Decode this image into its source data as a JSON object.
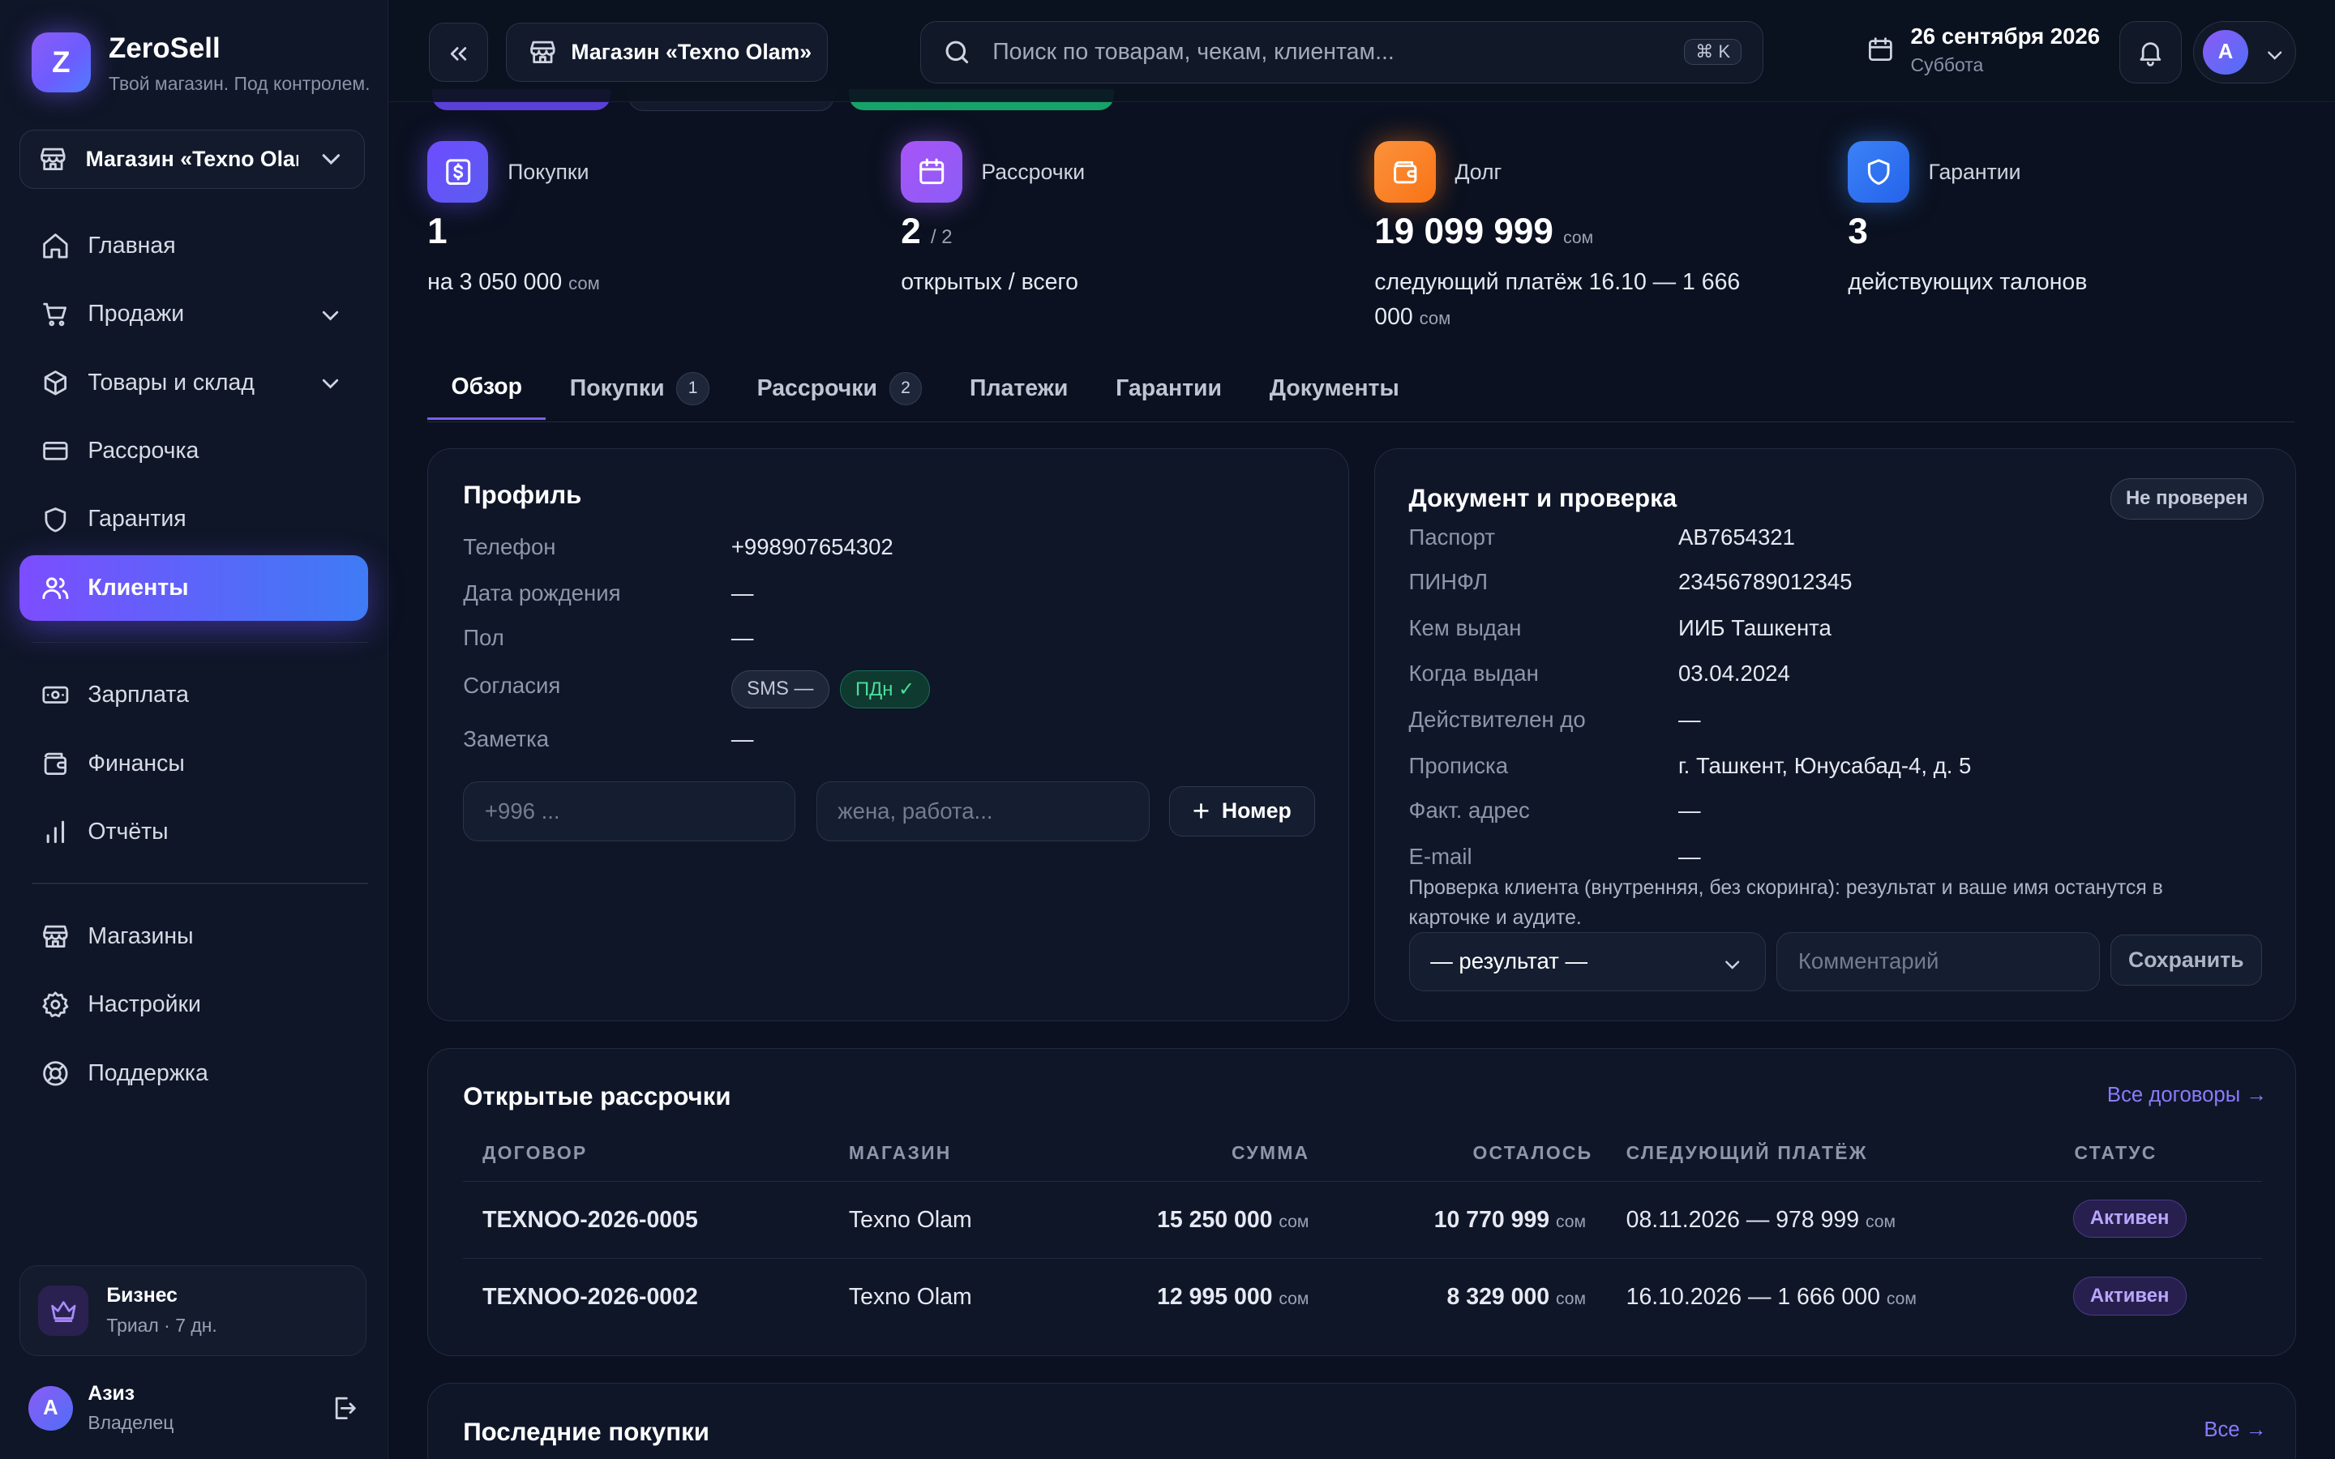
{
  "brand": {
    "name": "ZeroSell",
    "tagline": "Твой магазин. Под контролем.",
    "logo_letter": "Z"
  },
  "sidebar": {
    "store": "Магазин «Texno Olam»",
    "items": [
      {
        "label": "Главная",
        "icon": "home-icon"
      },
      {
        "label": "Продажи",
        "icon": "cart-icon",
        "expandable": true
      },
      {
        "label": "Товары и склад",
        "icon": "box-icon",
        "expandable": true
      },
      {
        "label": "Рассрочка",
        "icon": "card-icon"
      },
      {
        "label": "Гарантия",
        "icon": "shield-icon"
      },
      {
        "label": "Клиенты",
        "icon": "users-icon",
        "active": true
      },
      {
        "label": "Зарплата",
        "icon": "cash-icon"
      },
      {
        "label": "Финансы",
        "icon": "wallet-icon"
      },
      {
        "label": "Отчёты",
        "icon": "chart-icon"
      },
      {
        "label": "Магазины",
        "icon": "store-icon"
      },
      {
        "label": "Настройки",
        "icon": "gear-icon"
      },
      {
        "label": "Поддержка",
        "icon": "lifebuoy-icon"
      }
    ],
    "plan": {
      "title": "Бизнес",
      "subtitle": "Триал · 7 дн."
    },
    "user": {
      "initial": "А",
      "name": "Азиз",
      "role": "Владелец"
    }
  },
  "topbar": {
    "store": "Магазин «Texno Olam»",
    "search_placeholder": "Поиск по товарам, чекам, клиентам...",
    "shortcut": "⌘ K",
    "date": "26 сентября 2026",
    "weekday": "Суббота",
    "account_initial": "A"
  },
  "stats": [
    {
      "label": "Покупки",
      "value": "1",
      "value_suffix": "",
      "desc": "на 3 050 000",
      "desc_unit": "сом",
      "color": "#6d4dff"
    },
    {
      "label": "Рассрочки",
      "value": "2",
      "value_suffix": "/ 2",
      "desc": "открытых / всего",
      "desc_unit": "",
      "color": "#9b5cf6"
    },
    {
      "label": "Долг",
      "value": "19 099 999",
      "value_unit": "сом",
      "desc": "следующий платёж 16.10 — 1 666 000",
      "desc_unit": "сом",
      "color": "#f97316"
    },
    {
      "label": "Гарантии",
      "value": "3",
      "value_suffix": "",
      "desc": "действующих талонов",
      "desc_unit": "",
      "color": "#3b82f6"
    }
  ],
  "tabs": [
    {
      "label": "Обзор",
      "active": true
    },
    {
      "label": "Покупки",
      "count": "1"
    },
    {
      "label": "Рассрочки",
      "count": "2"
    },
    {
      "label": "Платежи"
    },
    {
      "label": "Гарантии"
    },
    {
      "label": "Документы"
    }
  ],
  "profile": {
    "title": "Профиль",
    "fields": [
      {
        "label": "Телефон",
        "value": "+998907654302"
      },
      {
        "label": "Дата рождения",
        "value": "—"
      },
      {
        "label": "Пол",
        "value": "—"
      },
      {
        "label": "Согласия",
        "value": ""
      },
      {
        "label": "Заметка",
        "value": "—"
      }
    ],
    "consents": [
      {
        "label": "SMS —"
      },
      {
        "label": "ПДн ✓"
      }
    ],
    "phone_placeholder": "+996 ...",
    "note_placeholder": "жена, работа...",
    "add_button": "Номер"
  },
  "document": {
    "title": "Документ и проверка",
    "status": "Не проверен",
    "fields": [
      {
        "label": "Паспорт",
        "value": "AB7654321"
      },
      {
        "label": "ПИНФЛ",
        "value": "23456789012345"
      },
      {
        "label": "Кем выдан",
        "value": "ИИБ Ташкента"
      },
      {
        "label": "Когда выдан",
        "value": "03.04.2024"
      },
      {
        "label": "Действителен до",
        "value": "—"
      },
      {
        "label": "Прописка",
        "value": "г. Ташкент, Юнусабад-4, д. 5"
      },
      {
        "label": "Факт. адрес",
        "value": "—"
      },
      {
        "label": "E-mail",
        "value": "—"
      }
    ],
    "note": "Проверка клиента (внутренняя, без скоринга): результат и ваше имя останутся в карточке и аудите.",
    "result_select": "— результат —",
    "comment_placeholder": "Комментарий",
    "save_button": "Сохранить"
  },
  "installments": {
    "title": "Открытые рассрочки",
    "all_link": "Все договоры →",
    "columns": [
      "ДОГОВОР",
      "МАГАЗИН",
      "СУММА",
      "ОСТАЛОСЬ",
      "СЛЕДУЮЩИЙ ПЛАТЁЖ",
      "СТАТУС"
    ],
    "rows": [
      {
        "contract": "TEXNOO-2026-0005",
        "store": "Texno Olam",
        "sum": "15 250 000",
        "left": "10 770 999",
        "next": "08.11.2026 — 978 999",
        "status": "Активен"
      },
      {
        "contract": "TEXNOO-2026-0002",
        "store": "Texno Olam",
        "sum": "12 995 000",
        "left": "8 329 000",
        "next": "16.10.2026 — 1 666 000",
        "status": "Активен"
      }
    ],
    "currency": "сом"
  },
  "purchases": {
    "title": "Последние покупки",
    "all_link": "Все →"
  }
}
